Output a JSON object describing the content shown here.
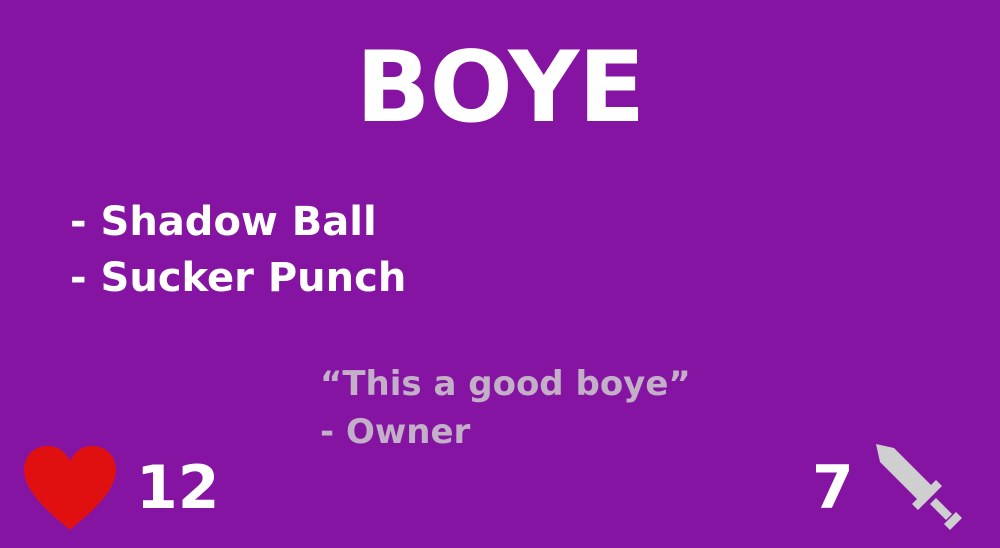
{
  "card": {
    "name": "BOYE",
    "moves": [
      "- Shadow Ball",
      "- Sucker Punch"
    ],
    "quote": {
      "text": "“This a good boye”",
      "author": "- Owner"
    },
    "stats": {
      "health": "12",
      "attack": "7"
    }
  },
  "icons": {
    "health": "heart-icon",
    "attack": "sword-icon"
  },
  "colors": {
    "background": "#8514a3",
    "text": "#ffffff",
    "quote": "#c3b0c8",
    "heart": "#e01010",
    "sword": "#cfcfcf"
  }
}
